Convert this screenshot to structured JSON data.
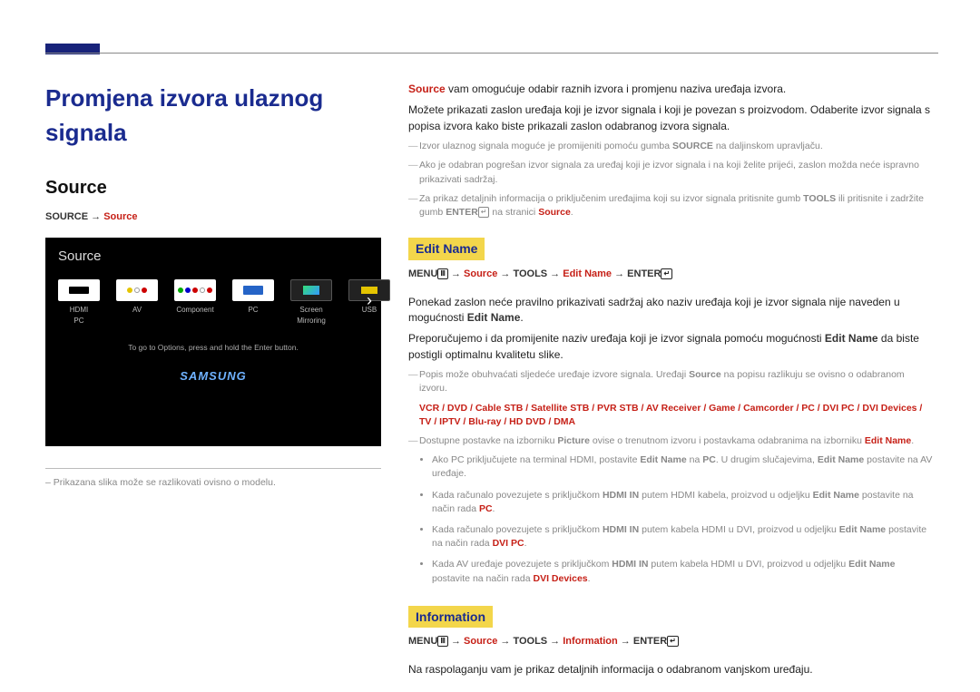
{
  "header": {
    "title": "Promjena izvora ulaznog signala"
  },
  "left": {
    "h2": "Source",
    "path_pre": "SOURCE → ",
    "path_src": "Source",
    "ss": {
      "title": "Source",
      "items": [
        {
          "label": "HDMI\nPC"
        },
        {
          "label": "AV"
        },
        {
          "label": "Component"
        },
        {
          "label": "PC"
        },
        {
          "label": "Screen Mirroring"
        },
        {
          "label": "USB"
        }
      ],
      "hint": "To go to Options, press and hold the Enter button.",
      "logo": "SAMSUNG"
    },
    "caption_dash": "– ",
    "caption": "Prikazana slika može se razlikovati ovisno o modelu."
  },
  "right": {
    "p1_a": "Source",
    "p1_b": " vam omogućuje odabir raznih izvora i promjenu naziva uređaja izvora.",
    "p2": "Možete prikazati zaslon uređaja koji je izvor signala i koji je povezan s proizvodom. Odaberite izvor signala s popisa izvora kako biste prikazali zaslon odabranog izvora signala.",
    "n1_a": "Izvor ulaznog signala moguće je promijeniti pomoću gumba ",
    "n1_b": "SOURCE",
    "n1_c": " na daljinskom upravljaču.",
    "n2": "Ako je odabran pogrešan izvor signala za uređaj koji je izvor signala i na koji želite prijeći, zaslon možda neće ispravno prikazivati sadržaj.",
    "n3_a": "Za prikaz detaljnih informacija o priključenim uređajima koji su izvor signala pritisnite gumb ",
    "n3_b": "TOOLS",
    "n3_c": " ili pritisnite i zadržite gumb ",
    "n3_d": "ENTER",
    "n3_e": " na stranici ",
    "n3_f": "Source",
    "n3_g": ".",
    "edit_head": "Edit Name",
    "edit_path_a": "MENU",
    "edit_path_b": " → ",
    "edit_path_c": "Source",
    "edit_path_d": " → TOOLS → ",
    "edit_path_e": "Edit Name",
    "edit_path_f": " → ENTER",
    "ep1_a": "Ponekad zaslon neće pravilno prikazivati sadržaj ako naziv uređaja koji je izvor signala nije naveden u mogućnosti ",
    "ep1_b": "Edit Name",
    "ep1_c": ".",
    "ep2_a": "Preporučujemo i da promijenite naziv uređaja koji je izvor signala pomoću mogućnosti ",
    "ep2_b": "Edit Name",
    "ep2_c": " da biste postigli optimalnu kvalitetu slike.",
    "en1_a": "Popis može obuhvaćati sljedeće uređaje izvore signala. Uređaji ",
    "en1_b": "Source",
    "en1_c": " na popisu razlikuju se ovisno o odabranom izvoru.",
    "devlist": "VCR / DVD / Cable STB / Satellite STB / PVR STB / AV Receiver / Game / Camcorder / PC / DVI PC / DVI Devices / TV / IPTV / Blu-ray / HD DVD / DMA",
    "en2_a": "Dostupne postavke na izborniku ",
    "en2_b": "Picture",
    "en2_c": " ovise o trenutnom izvoru i postavkama odabranima na izborniku ",
    "en2_d": "Edit Name",
    "en2_e": ".",
    "bl1_a": "Ako PC priključujete na terminal HDMI, postavite ",
    "bl1_b": "Edit Name",
    "bl1_c": " na ",
    "bl1_d": "PC",
    "bl1_e": ". U drugim slučajevima, ",
    "bl1_f": "Edit Name",
    "bl1_g": " postavite na AV uređaje.",
    "bl2_a": "Kada računalo povezujete s priključkom ",
    "bl2_b": "HDMI IN",
    "bl2_c": " putem HDMI kabela, proizvod u odjeljku ",
    "bl2_d": "Edit Name",
    "bl2_e": " postavite na način rada ",
    "bl2_f": "PC",
    "bl2_g": ".",
    "bl3_a": "Kada računalo povezujete s priključkom ",
    "bl3_b": "HDMI IN",
    "bl3_c": " putem kabela HDMI u DVI, proizvod u odjeljku ",
    "bl3_d": "Edit Name",
    "bl3_e": " postavite na način rada ",
    "bl3_f": "DVI PC",
    "bl3_g": ".",
    "bl4_a": "Kada AV uređaje povezujete s priključkom ",
    "bl4_b": "HDMI IN",
    "bl4_c": " putem kabela HDMI u DVI, proizvod u odjeljku ",
    "bl4_d": "Edit Name",
    "bl4_e": " postavite na način rada ",
    "bl4_f": "DVI Devices",
    "bl4_g": ".",
    "info_head": "Information",
    "info_path_a": "MENU",
    "info_path_b": " → ",
    "info_path_c": "Source",
    "info_path_d": " → TOOLS → ",
    "info_path_e": "Information",
    "info_path_f": " → ENTER",
    "info_p": "Na raspolaganju vam je prikaz detaljnih informacija o odabranom vanjskom uređaju."
  }
}
